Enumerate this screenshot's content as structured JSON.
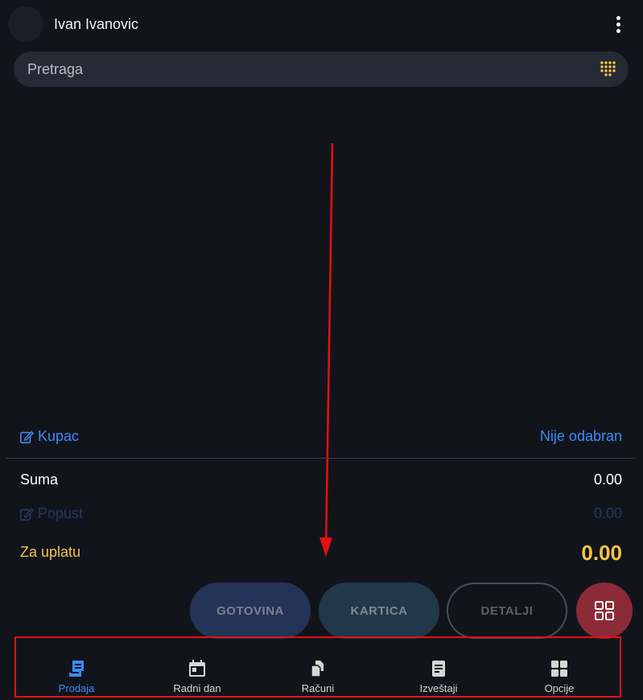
{
  "header": {
    "user_name": "Ivan Ivanovic",
    "menu_icon": "more-vertical-icon"
  },
  "search": {
    "placeholder": "Pretraga",
    "value": "",
    "keypad_icon": "dialpad-icon",
    "keypad_color": "#f5c542"
  },
  "summary": {
    "customer_label": "Kupac",
    "customer_value": "Nije odabran",
    "sum_label": "Suma",
    "sum_value": "0.00",
    "discount_label": "Popust",
    "discount_value": "0.00",
    "total_label": "Za uplatu",
    "total_value": "0.00"
  },
  "actions": {
    "cash_label": "GOTOVINA",
    "card_label": "KARTICA",
    "details_label": "DETALJI",
    "grid_icon": "grid-icon"
  },
  "nav": {
    "items": [
      {
        "label": "Prodaja",
        "icon": "receipt-icon",
        "active": true
      },
      {
        "label": "Radni dan",
        "icon": "calendar-icon",
        "active": false
      },
      {
        "label": "Računi",
        "icon": "documents-icon",
        "active": false
      },
      {
        "label": "Izveštaji",
        "icon": "report-icon",
        "active": false
      },
      {
        "label": "Opcije",
        "icon": "apps-icon",
        "active": false
      }
    ]
  },
  "colors": {
    "background": "#12141c",
    "accent_blue": "#3d8bf5",
    "accent_yellow": "#f5c542",
    "annotation_red": "#e31212",
    "grid_button": "#8c2b38"
  }
}
